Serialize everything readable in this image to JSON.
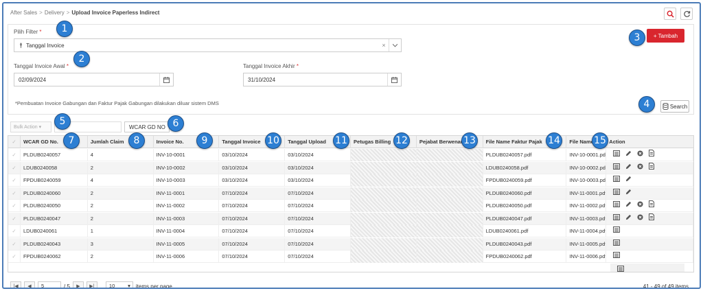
{
  "breadcrumb": {
    "items": [
      "After Sales",
      "Delivery"
    ],
    "current": "Upload Invoice Paperless Indirect"
  },
  "filter": {
    "pilih_filter_label": "Pilih Filter",
    "pilih_filter_value": "Tanggal Invoice",
    "awal_label": "Tanggal Invoice Awal",
    "awal_value": "02/09/2024",
    "akhir_label": "Tanggal Invoice Akhir",
    "akhir_value": "31/10/2024",
    "required_mark": "*",
    "note": "*Pembuatan Invoice Gabungan dan Faktur Pajak Gabungan dilakukan diluar sistem DMS",
    "tambah_label": "+ Tambah",
    "search_label": "Search"
  },
  "toolbar": {
    "bulk_action": "Bulk Action",
    "wcar_button": "WCAR GD NO"
  },
  "table": {
    "columns": [
      "WCAR GD No.",
      "Jumlah Claim",
      "Invoice No.",
      "Tanggal Invoice",
      "Tanggal Upload",
      "Petugas Billing",
      "Pejabat Berwenang",
      "File Name Faktur Pajak",
      "File Name",
      "Action"
    ],
    "rows": [
      {
        "wcar": "PLDUB0240057",
        "jumlah": "4",
        "invoice": "INV-10-0001",
        "tgl_inv": "03/10/2024",
        "tgl_up": "03/10/2024",
        "faktur": "PLDUB0240057.pdf",
        "file": "INV-10-0001.pdf"
      },
      {
        "wcar": "LDUB0240058",
        "jumlah": "2",
        "invoice": "INV-10-0002",
        "tgl_inv": "03/10/2024",
        "tgl_up": "03/10/2024",
        "faktur": "LDUB0240058.pdf",
        "file": "INV-10-0002.pdf"
      },
      {
        "wcar": "FPDUB0240059",
        "jumlah": "4",
        "invoice": "INV-10-0003",
        "tgl_inv": "03/10/2024",
        "tgl_up": "03/10/2024",
        "faktur": "FPDUB0240059.pdf",
        "file": "INV-10-0003.pdf"
      },
      {
        "wcar": "PLDUB0240060",
        "jumlah": "2",
        "invoice": "INV-11-0001",
        "tgl_inv": "07/10/2024",
        "tgl_up": "07/10/2024",
        "faktur": "PLDUB0240060.pdf",
        "file": "INV-11-0001.pdf"
      },
      {
        "wcar": "PLDUB0240050",
        "jumlah": "2",
        "invoice": "INV-11-0002",
        "tgl_inv": "07/10/2024",
        "tgl_up": "07/10/2024",
        "faktur": "PLDUB0240050.pdf",
        "file": "INV-11-0002.pdf"
      },
      {
        "wcar": "PLDUB0240047",
        "jumlah": "2",
        "invoice": "INV-11-0003",
        "tgl_inv": "07/10/2024",
        "tgl_up": "07/10/2024",
        "faktur": "PLDUB0240047.pdf",
        "file": "INV-11-0003.pdf"
      },
      {
        "wcar": "LDUB0240061",
        "jumlah": "1",
        "invoice": "INV-11-0004",
        "tgl_inv": "07/10/2024",
        "tgl_up": "07/10/2024",
        "faktur": "LDUB0240061.pdf",
        "file": "INV-11-0004.pdf"
      },
      {
        "wcar": "PLDUB0240043",
        "jumlah": "3",
        "invoice": "INV-11-0005",
        "tgl_inv": "07/10/2024",
        "tgl_up": "07/10/2024",
        "faktur": "PLDUB0240043.pdf",
        "file": "INV-11-0005.pdf"
      },
      {
        "wcar": "FPDUB0240062",
        "jumlah": "2",
        "invoice": "INV-11-0006",
        "tgl_inv": "07/10/2024",
        "tgl_up": "07/10/2024",
        "faktur": "FPDUB0240062.pdf",
        "file": "INV-11-0006.pdf"
      }
    ],
    "row_actions": [
      [
        "list-icon",
        "pencil-icon",
        "delete-icon",
        "document-icon"
      ],
      [
        "list-icon",
        "pencil-icon",
        "delete-icon",
        "document-icon"
      ],
      [
        "list-icon",
        "pencil-icon"
      ],
      [
        "list-icon",
        "pencil-icon"
      ],
      [
        "list-icon",
        "pencil-icon",
        "delete-icon",
        "document-icon"
      ],
      [
        "list-icon",
        "pencil-icon",
        "delete-icon",
        "document-icon"
      ],
      [
        "list-icon"
      ],
      [
        "list-icon"
      ],
      [
        "list-icon"
      ],
      [
        "list-icon"
      ],
      [
        "list-icon"
      ]
    ]
  },
  "pager": {
    "page": "5",
    "of": "/ 5",
    "per_page": "10",
    "per_page_label": "items per page",
    "info": "41 - 49 of 49 items"
  },
  "badges": [
    "1",
    "2",
    "3",
    "4",
    "5",
    "6",
    "7",
    "8",
    "9",
    "10",
    "11",
    "12",
    "13",
    "14",
    "15"
  ],
  "colors": {
    "primary_button": "#d9262e",
    "badge": "#2d7fd3",
    "frame": "#4a7bb7"
  }
}
